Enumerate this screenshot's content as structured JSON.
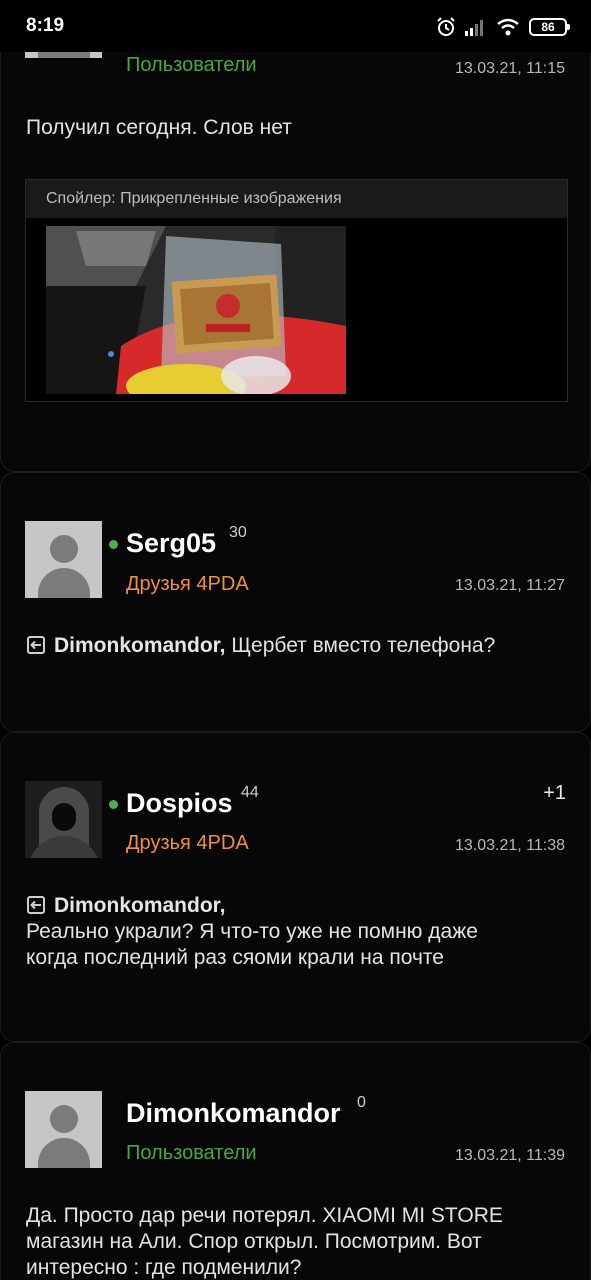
{
  "statusbar": {
    "time": "8:19",
    "battery": "86",
    "icons": [
      "alarm-icon",
      "signal-icon",
      "wifi-icon",
      "battery-icon"
    ]
  },
  "colors": {
    "background": "#000000",
    "users_group": "#4aa83e",
    "friends_group": "#f0913a",
    "online": "#4caf50"
  },
  "posts": [
    {
      "group": "Пользователи",
      "date": "13.03.21, 11:15",
      "text": "Получил сегодня. Слов нет",
      "spoiler_title": "Спойлер: Прикрепленные изображения"
    },
    {
      "nick": "Serg05",
      "rep": "30",
      "group": "Друзья 4PDA",
      "date": "13.03.21, 11:27",
      "quote_name": "Dimonkomandor,",
      "text": " Щербет вместо телефона?"
    },
    {
      "nick": "Dospios",
      "rep": "44",
      "vote": "+1",
      "group": "Друзья 4PDA",
      "date": "13.03.21, 11:38",
      "quote_name": "Dimonkomandor,",
      "text_line1": "Реально украли? Я что-то уже не помню даже",
      "text_line2": "когда последний раз сяоми крали на почте"
    },
    {
      "nick": "Dimonkomandor",
      "rep": "0",
      "group": "Пользователи",
      "date": "13.03.21, 11:39",
      "text_line1": "Да. Просто дар речи потерял. XIAOMI MI STORE",
      "text_line2": "магазин на Али. Спор открыл. Посмотрим. Вот",
      "text_line3": "интересно : где  подменили?"
    }
  ]
}
